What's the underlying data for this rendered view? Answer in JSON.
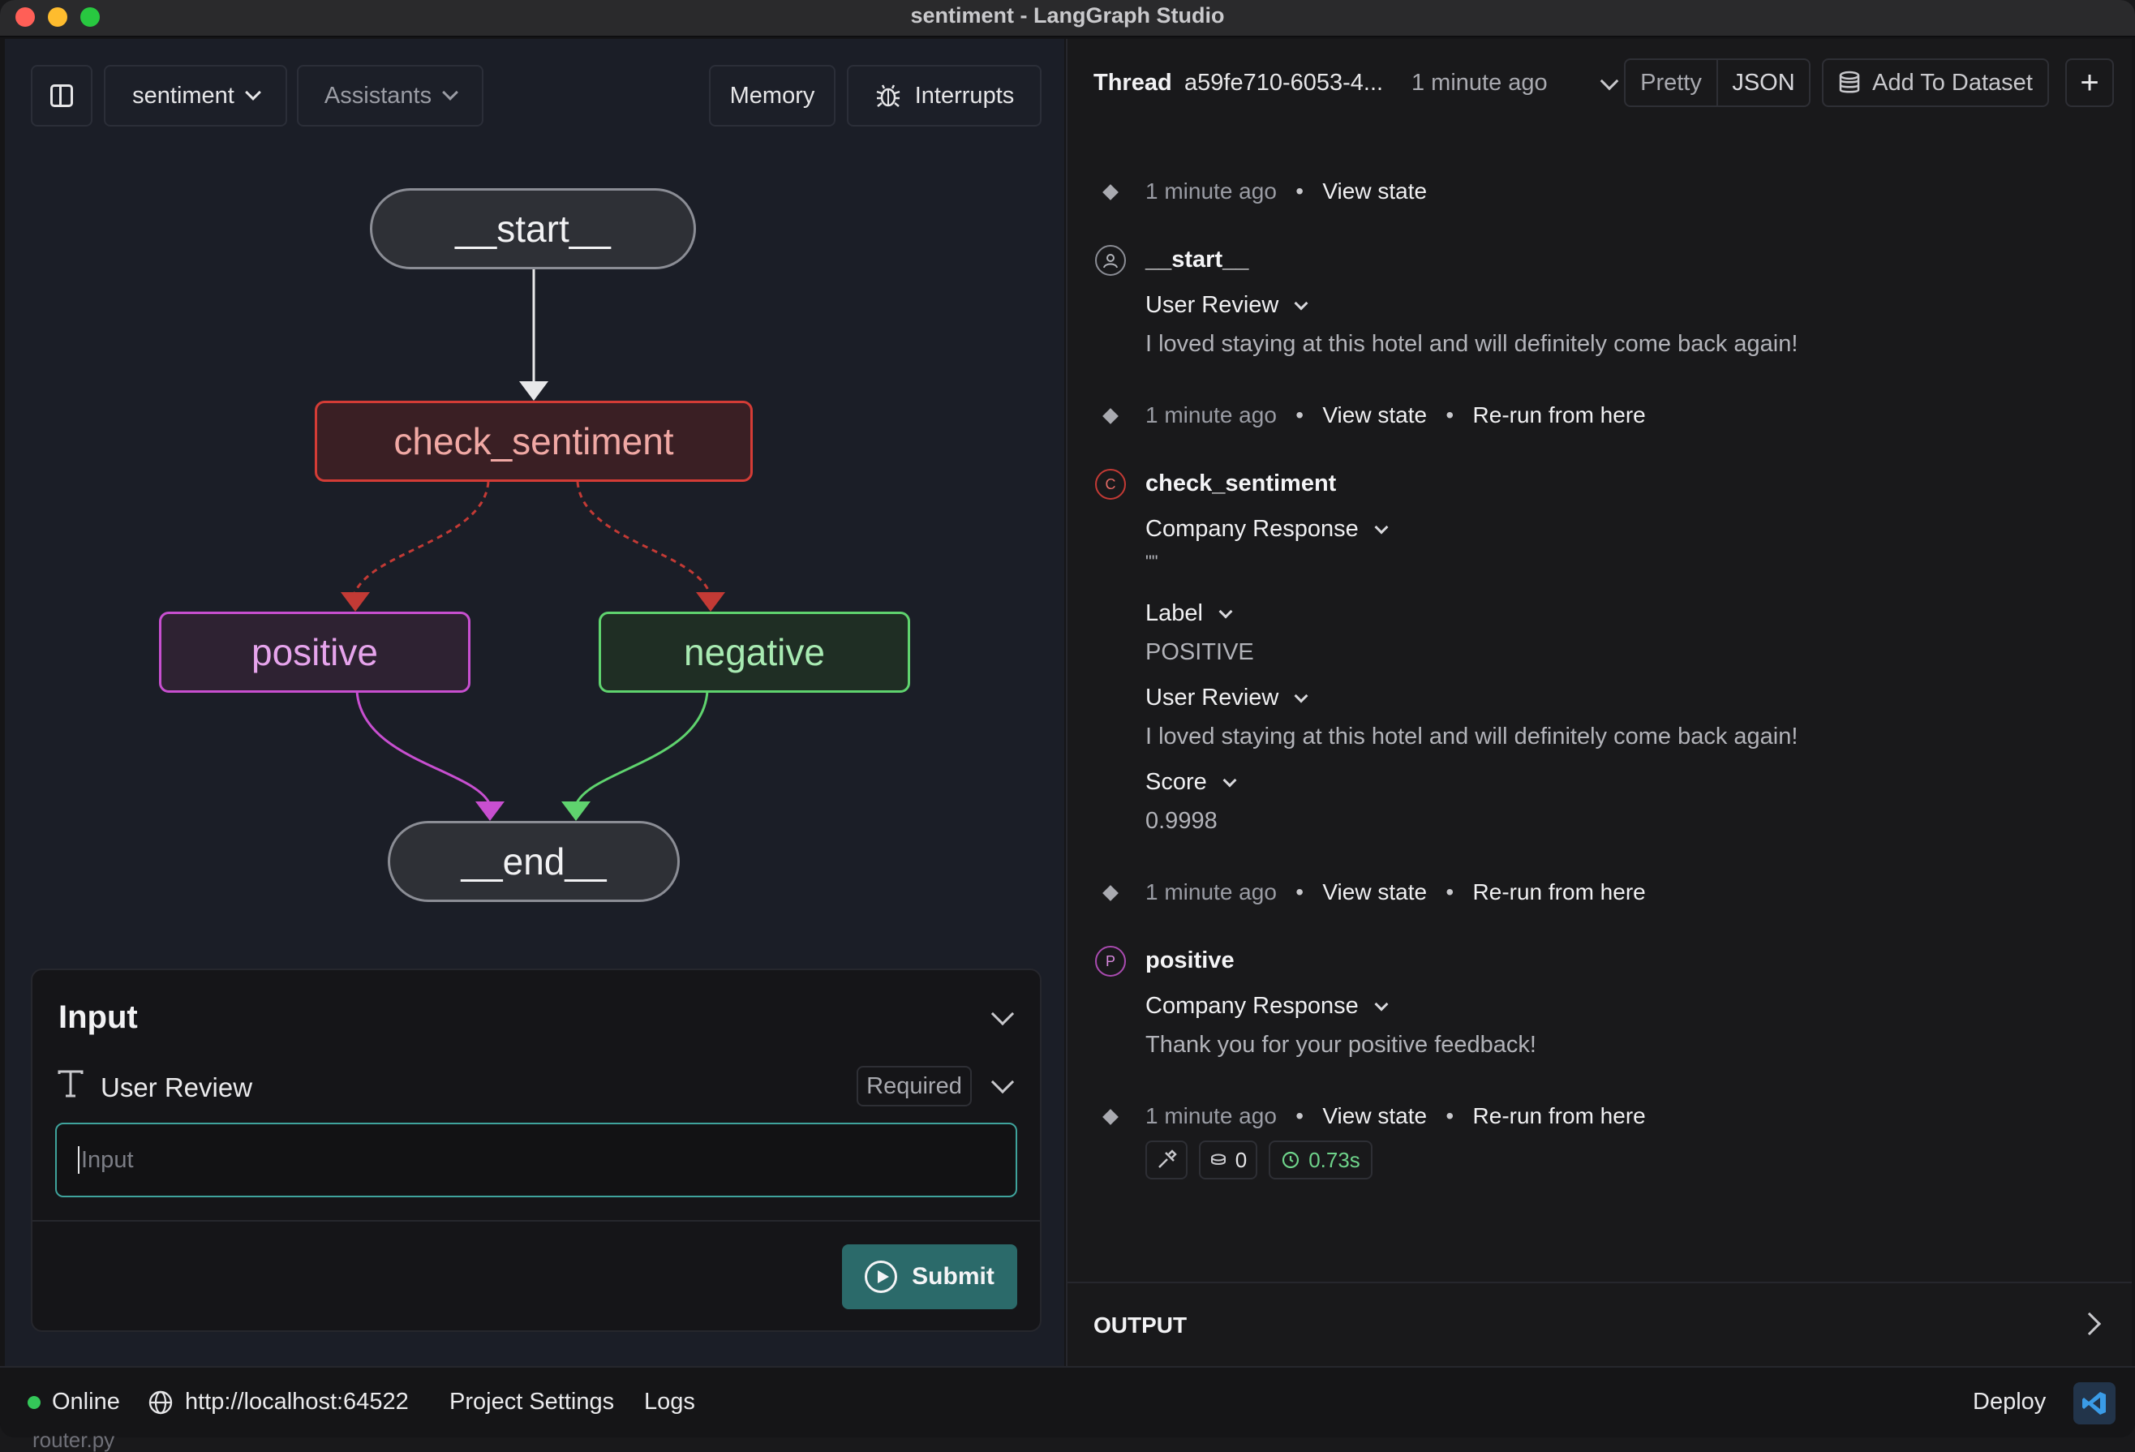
{
  "window": {
    "title": "sentiment - LangGraph Studio"
  },
  "toolbar": {
    "graph_select": "sentiment",
    "assistants_select": "Assistants",
    "memory_label": "Memory",
    "interrupts_label": "Interrupts"
  },
  "graph": {
    "nodes": {
      "start": "__start__",
      "check_sentiment": "check_sentiment",
      "positive": "positive",
      "negative": "negative",
      "end": "__end__"
    }
  },
  "input_panel": {
    "title": "Input",
    "field_label": "User Review",
    "required_label": "Required",
    "placeholder": "Input",
    "submit_label": "Submit"
  },
  "thread": {
    "label": "Thread",
    "id": "a59fe710-6053-4...",
    "time": "1 minute ago",
    "view_pretty": "Pretty",
    "view_json": "JSON",
    "add_dataset": "Add To Dataset",
    "plus": "+"
  },
  "timeline": {
    "meta_time": "1 minute ago",
    "view_state": "View state",
    "rerun": "Re-run from here",
    "steps": [
      {
        "name": "__start__",
        "fields": [
          {
            "label": "User Review",
            "value": "I loved staying at this hotel and will definitely come back again!"
          }
        ]
      },
      {
        "name": "check_sentiment",
        "avatar": "C",
        "fields": [
          {
            "label": "Company Response",
            "value": "\"\""
          },
          {
            "label": "Label",
            "value": "POSITIVE"
          },
          {
            "label": "User Review",
            "value": "I loved staying at this hotel and will definitely come back again!"
          },
          {
            "label": "Score",
            "value": "0.9998"
          }
        ]
      },
      {
        "name": "positive",
        "avatar": "P",
        "fields": [
          {
            "label": "Company Response",
            "value": "Thank you for your positive feedback!"
          }
        ]
      }
    ],
    "badges": {
      "tokens": "0",
      "duration": "0.73s"
    }
  },
  "output": {
    "label": "OUTPUT"
  },
  "footer": {
    "status": "Online",
    "url": "http://localhost:64522",
    "project_settings": "Project Settings",
    "logs": "Logs",
    "deploy": "Deploy"
  },
  "background": {
    "file_hint": "router.py"
  },
  "colors": {
    "accent_teal": "#2b6a6a",
    "check_sentiment": "#e0403a",
    "positive": "#c84fd0",
    "negative": "#5fd36e",
    "online": "#34c759"
  }
}
